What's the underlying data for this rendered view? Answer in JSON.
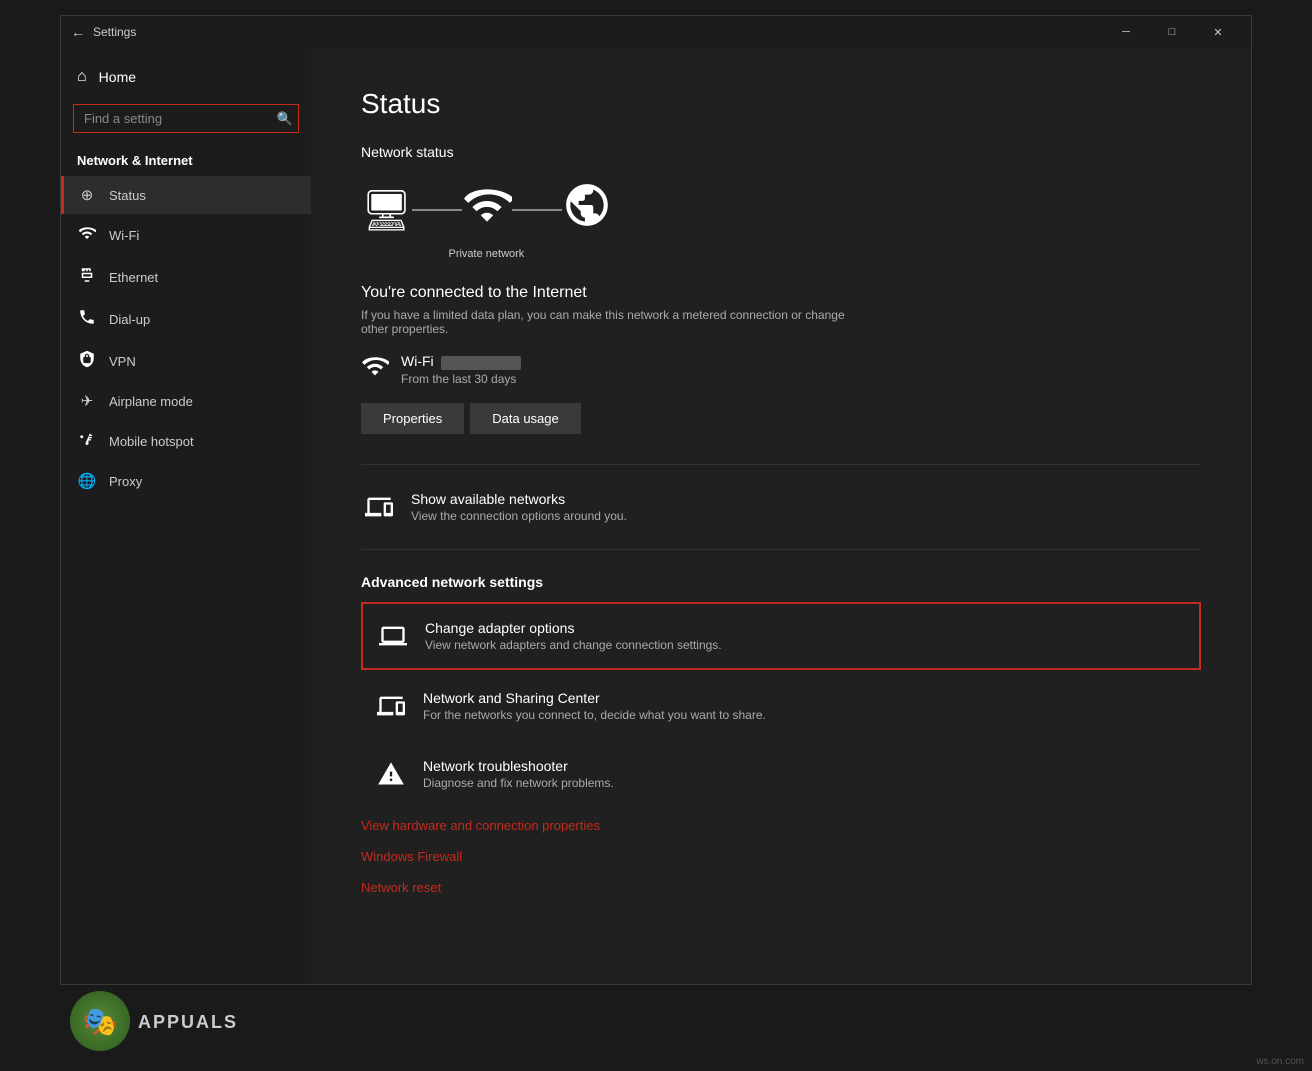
{
  "window": {
    "title": "Settings",
    "controls": {
      "minimize": "─",
      "maximize": "□",
      "close": "✕"
    }
  },
  "sidebar": {
    "home_label": "Home",
    "search_placeholder": "Find a setting",
    "section_title": "Network & Internet",
    "items": [
      {
        "id": "status",
        "label": "Status",
        "active": true,
        "icon": "🌐"
      },
      {
        "id": "wifi",
        "label": "Wi-Fi",
        "icon": "📶"
      },
      {
        "id": "ethernet",
        "label": "Ethernet",
        "icon": "🔌"
      },
      {
        "id": "dialup",
        "label": "Dial-up",
        "icon": "📞"
      },
      {
        "id": "vpn",
        "label": "VPN",
        "icon": "🔒"
      },
      {
        "id": "airplane",
        "label": "Airplane mode",
        "icon": "✈"
      },
      {
        "id": "hotspot",
        "label": "Mobile hotspot",
        "icon": "📡"
      },
      {
        "id": "proxy",
        "label": "Proxy",
        "icon": "🌐"
      }
    ]
  },
  "main": {
    "page_title": "Status",
    "network_status_title": "Network status",
    "network_label": "Private network",
    "connected_title": "You're connected to the Internet",
    "connected_desc": "If you have a limited data plan, you can make this network a metered connection or change other properties.",
    "wifi_name_blurred": true,
    "wifi_sub": "From the last 30 days",
    "buttons": {
      "properties": "Properties",
      "data_usage": "Data usage"
    },
    "available_networks": {
      "title": "Show available networks",
      "sub": "View the connection options around you."
    },
    "advanced_title": "Advanced network settings",
    "advanced_items": [
      {
        "id": "adapter",
        "title": "Change adapter options",
        "sub": "View network adapters and change connection settings.",
        "highlighted": true
      },
      {
        "id": "sharing",
        "title": "Network and Sharing Center",
        "sub": "For the networks you connect to, decide what you want to share.",
        "highlighted": false
      },
      {
        "id": "troubleshooter",
        "title": "Network troubleshooter",
        "sub": "Diagnose and fix network problems.",
        "highlighted": false
      }
    ],
    "links": [
      "View hardware and connection properties",
      "Windows Firewall",
      "Network reset"
    ]
  },
  "watermark": "ws.on.com"
}
